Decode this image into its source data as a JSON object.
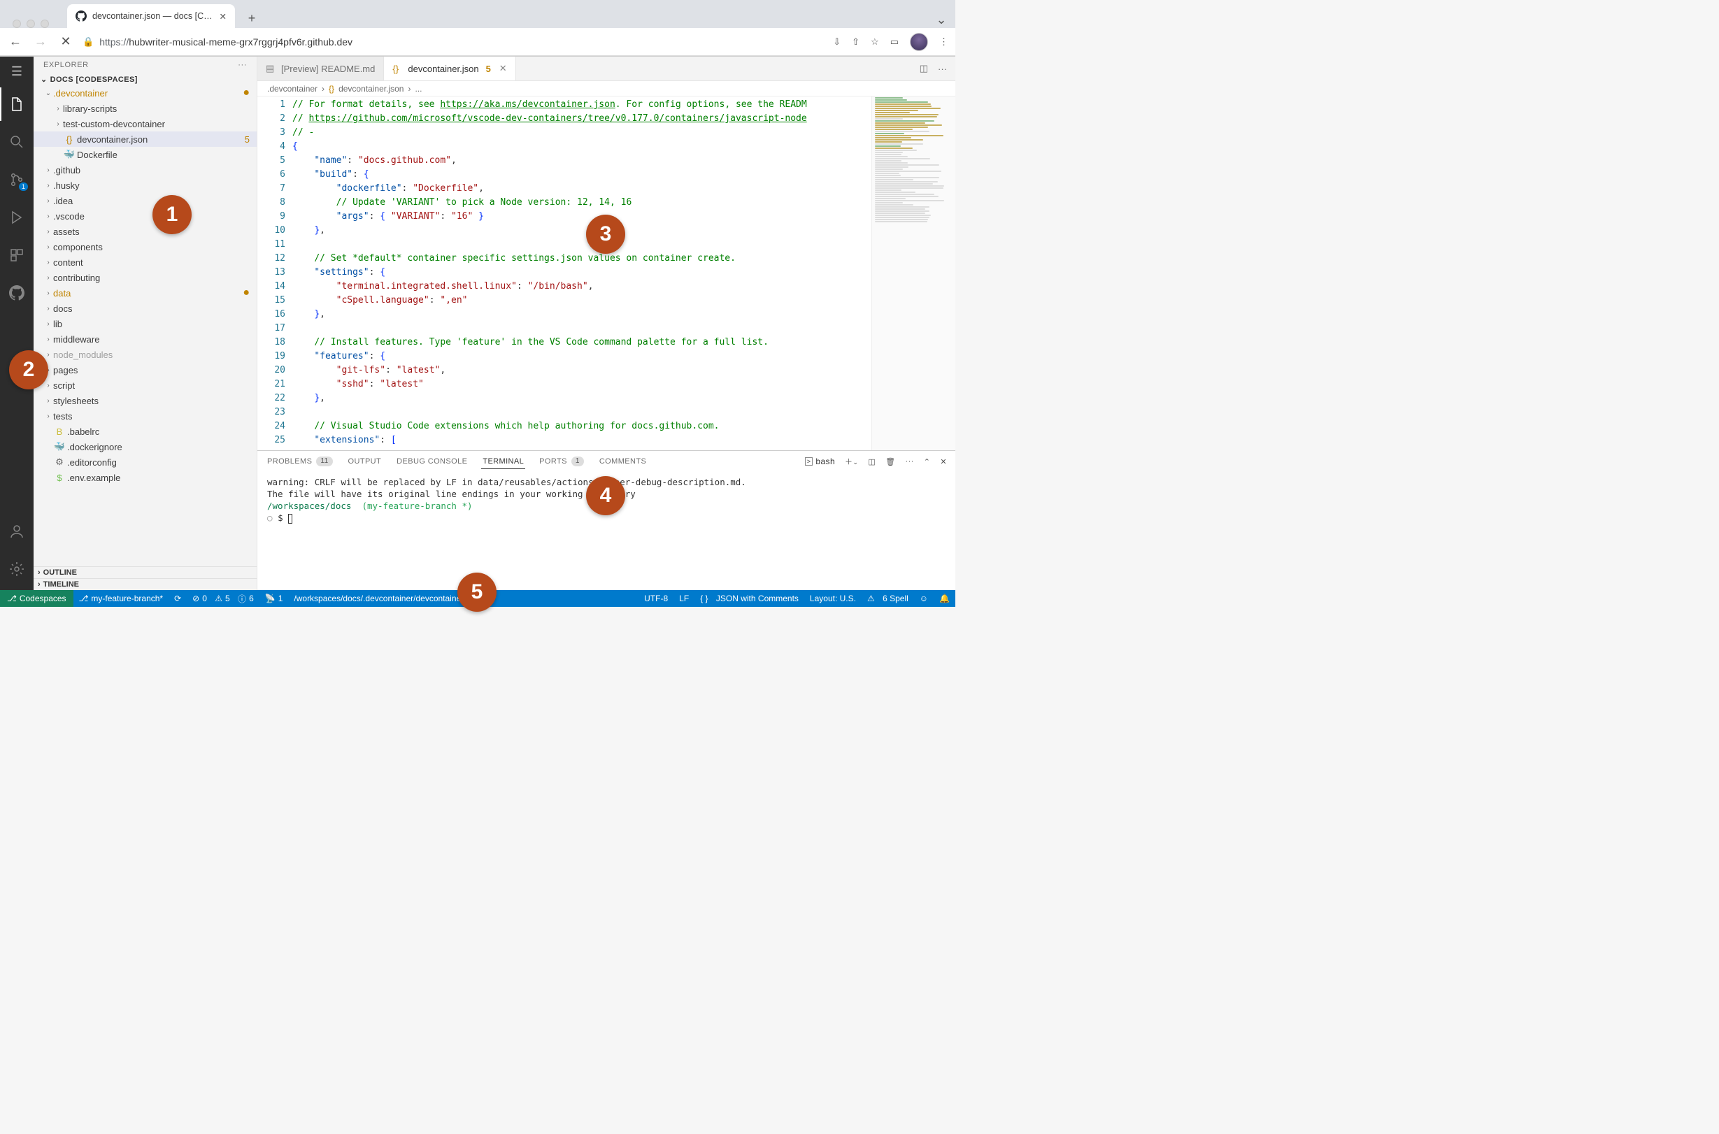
{
  "browser": {
    "tab_title": "devcontainer.json — docs [Cod…",
    "url_proto": "https://",
    "url_rest": "hubwriter-musical-meme-grx7rggrj4pfv6r.github.dev"
  },
  "sidebar": {
    "title": "EXPLORER",
    "root": "DOCS [CODESPACES]",
    "outline": "OUTLINE",
    "timeline": "TIMELINE",
    "items": [
      {
        "name": ".devcontainer",
        "type": "folder",
        "open": true,
        "modified": true,
        "depth": 1
      },
      {
        "name": "library-scripts",
        "type": "folder",
        "depth": 2
      },
      {
        "name": "test-custom-devcontainer",
        "type": "folder",
        "depth": 2
      },
      {
        "name": "devcontainer.json",
        "type": "file",
        "icon": "{}",
        "iconcolor": "#c08400",
        "selected": true,
        "modcount": "5",
        "depth": 2
      },
      {
        "name": "Dockerfile",
        "type": "file",
        "icon": "🐳",
        "depth": 2
      },
      {
        "name": ".github",
        "type": "folder",
        "depth": 1
      },
      {
        "name": ".husky",
        "type": "folder",
        "depth": 1
      },
      {
        "name": ".idea",
        "type": "folder",
        "depth": 1
      },
      {
        "name": ".vscode",
        "type": "folder",
        "depth": 1
      },
      {
        "name": "assets",
        "type": "folder",
        "depth": 1
      },
      {
        "name": "components",
        "type": "folder",
        "depth": 1
      },
      {
        "name": "content",
        "type": "folder",
        "depth": 1
      },
      {
        "name": "contributing",
        "type": "folder",
        "depth": 1
      },
      {
        "name": "data",
        "type": "folder",
        "modified": true,
        "depth": 1
      },
      {
        "name": "docs",
        "type": "folder",
        "depth": 1
      },
      {
        "name": "lib",
        "type": "folder",
        "depth": 1
      },
      {
        "name": "middleware",
        "type": "folder",
        "depth": 1
      },
      {
        "name": "node_modules",
        "type": "folder",
        "dim": true,
        "depth": 1
      },
      {
        "name": "pages",
        "type": "folder",
        "depth": 1
      },
      {
        "name": "script",
        "type": "folder",
        "depth": 1
      },
      {
        "name": "stylesheets",
        "type": "folder",
        "depth": 1
      },
      {
        "name": "tests",
        "type": "folder",
        "depth": 1
      },
      {
        "name": ".babelrc",
        "type": "file",
        "icon": "B",
        "iconcolor": "#cbbd3c",
        "depth": 1
      },
      {
        "name": ".dockerignore",
        "type": "file",
        "icon": "🐳",
        "iconcolor": "#9a9a9a",
        "depth": 1
      },
      {
        "name": ".editorconfig",
        "type": "file",
        "icon": "⚙",
        "iconcolor": "#666",
        "depth": 1
      },
      {
        "name": ".env.example",
        "type": "file",
        "icon": "$",
        "iconcolor": "#6fbf4c",
        "depth": 1
      }
    ]
  },
  "tabs": [
    {
      "icon": "▤",
      "label": "[Preview] README.md",
      "active": false
    },
    {
      "icon": "{}",
      "label": "devcontainer.json",
      "modnum": "5",
      "active": true
    }
  ],
  "breadcrumbs": {
    "folder": ".devcontainer",
    "file": "devcontainer.json",
    "tail": "..."
  },
  "code": {
    "lines": [
      {
        "n": 1,
        "html": "<span class='c-green'>// For format details, see </span><span class='c-link'>https://aka.ms/devcontainer.json</span><span class='c-green'>. For config options, see the READM</span>"
      },
      {
        "n": 2,
        "html": "<span class='c-green'>// </span><span class='c-link'>https://github.com/microsoft/vscode-dev-containers/tree/v0.177.0/containers/javascript-node</span>"
      },
      {
        "n": 3,
        "html": "<span class='c-green'>// -</span>"
      },
      {
        "n": 4,
        "html": "<span class='c-brace'>{</span>"
      },
      {
        "n": 5,
        "html": "    <span class='c-blue'>\"name\"</span>: <span class='c-string'>\"docs.github.com\"</span>,"
      },
      {
        "n": 6,
        "html": "    <span class='c-blue'>\"build\"</span>: <span class='c-brace'>{</span>"
      },
      {
        "n": 7,
        "html": "        <span class='c-blue'>\"dockerfile\"</span>: <span class='c-string'>\"Dockerfile\"</span>,"
      },
      {
        "n": 8,
        "html": "        <span class='c-green'>// Update 'VARIANT' to pick a Node version: 12, 14, 16</span>"
      },
      {
        "n": 9,
        "html": "        <span class='c-blue'>\"args\"</span>: <span class='c-brace'>{</span> <span class='c-string'>\"VARIANT\"</span>: <span class='c-string'>\"16\"</span> <span class='c-brace'>}</span>"
      },
      {
        "n": 10,
        "html": "    <span class='c-brace'>}</span>,"
      },
      {
        "n": 11,
        "html": ""
      },
      {
        "n": 12,
        "html": "    <span class='c-green'>// Set *default* container specific settings.json values on container create.</span>"
      },
      {
        "n": 13,
        "html": "    <span class='c-blue'>\"settings\"</span>: <span class='c-brace'>{</span>"
      },
      {
        "n": 14,
        "html": "        <span class='c-string'>\"terminal.integrated.shell.linux\"</span>: <span class='c-string'>\"/bin/bash\"</span>,"
      },
      {
        "n": 15,
        "html": "        <span class='c-string'>\"cSpell.language\"</span>: <span class='c-string'>\",en\"</span>"
      },
      {
        "n": 16,
        "html": "    <span class='c-brace'>}</span>,"
      },
      {
        "n": 17,
        "html": ""
      },
      {
        "n": 18,
        "html": "    <span class='c-green'>// Install features. Type 'feature' in the VS Code command palette for a full list.</span>"
      },
      {
        "n": 19,
        "html": "    <span class='c-blue'>\"features\"</span>: <span class='c-brace'>{</span>"
      },
      {
        "n": 20,
        "html": "        <span class='c-string'>\"git-lfs\"</span>: <span class='c-string'>\"latest\"</span>,"
      },
      {
        "n": 21,
        "html": "        <span class='c-string'>\"sshd\"</span>: <span class='c-string'>\"latest\"</span>"
      },
      {
        "n": 22,
        "html": "    <span class='c-brace'>}</span>,"
      },
      {
        "n": 23,
        "html": ""
      },
      {
        "n": 24,
        "html": "    <span class='c-green'>// Visual Studio Code extensions which help authoring for docs.github.com.</span>"
      },
      {
        "n": 25,
        "html": "    <span class='c-blue'>\"extensions\"</span>: <span class='c-brace'>[</span>"
      }
    ]
  },
  "panel": {
    "tabs": {
      "problems": "PROBLEMS",
      "problems_badge": "11",
      "output": "OUTPUT",
      "debug": "DEBUG CONSOLE",
      "terminal": "TERMINAL",
      "ports": "PORTS",
      "ports_badge": "1",
      "comments": "COMMENTS"
    },
    "term_profile": "bash",
    "term": {
      "line1": "warning: CRLF will be replaced by LF in data/reusables/actions/runner-debug-description.md.",
      "line2": "The file will have its original line endings in your working directory",
      "path": "/workspaces/docs",
      "branch": "(my-feature-branch *)",
      "prompt": "$"
    }
  },
  "statusbar": {
    "remote": "Codespaces",
    "branch": "my-feature-branch*",
    "sync": "⟳",
    "errors": "0",
    "warnings": "5",
    "info": "6",
    "port": "1",
    "path": "/workspaces/docs/.devcontainer/devcontainer.json",
    "encoding": "UTF-8",
    "eol": "LF",
    "lang": "JSON with Comments",
    "layout": "Layout: U.S.",
    "spell": "6 Spell"
  },
  "activitybar": {
    "scm_badge": "1"
  },
  "annotations": [
    "1",
    "2",
    "3",
    "4",
    "5"
  ]
}
